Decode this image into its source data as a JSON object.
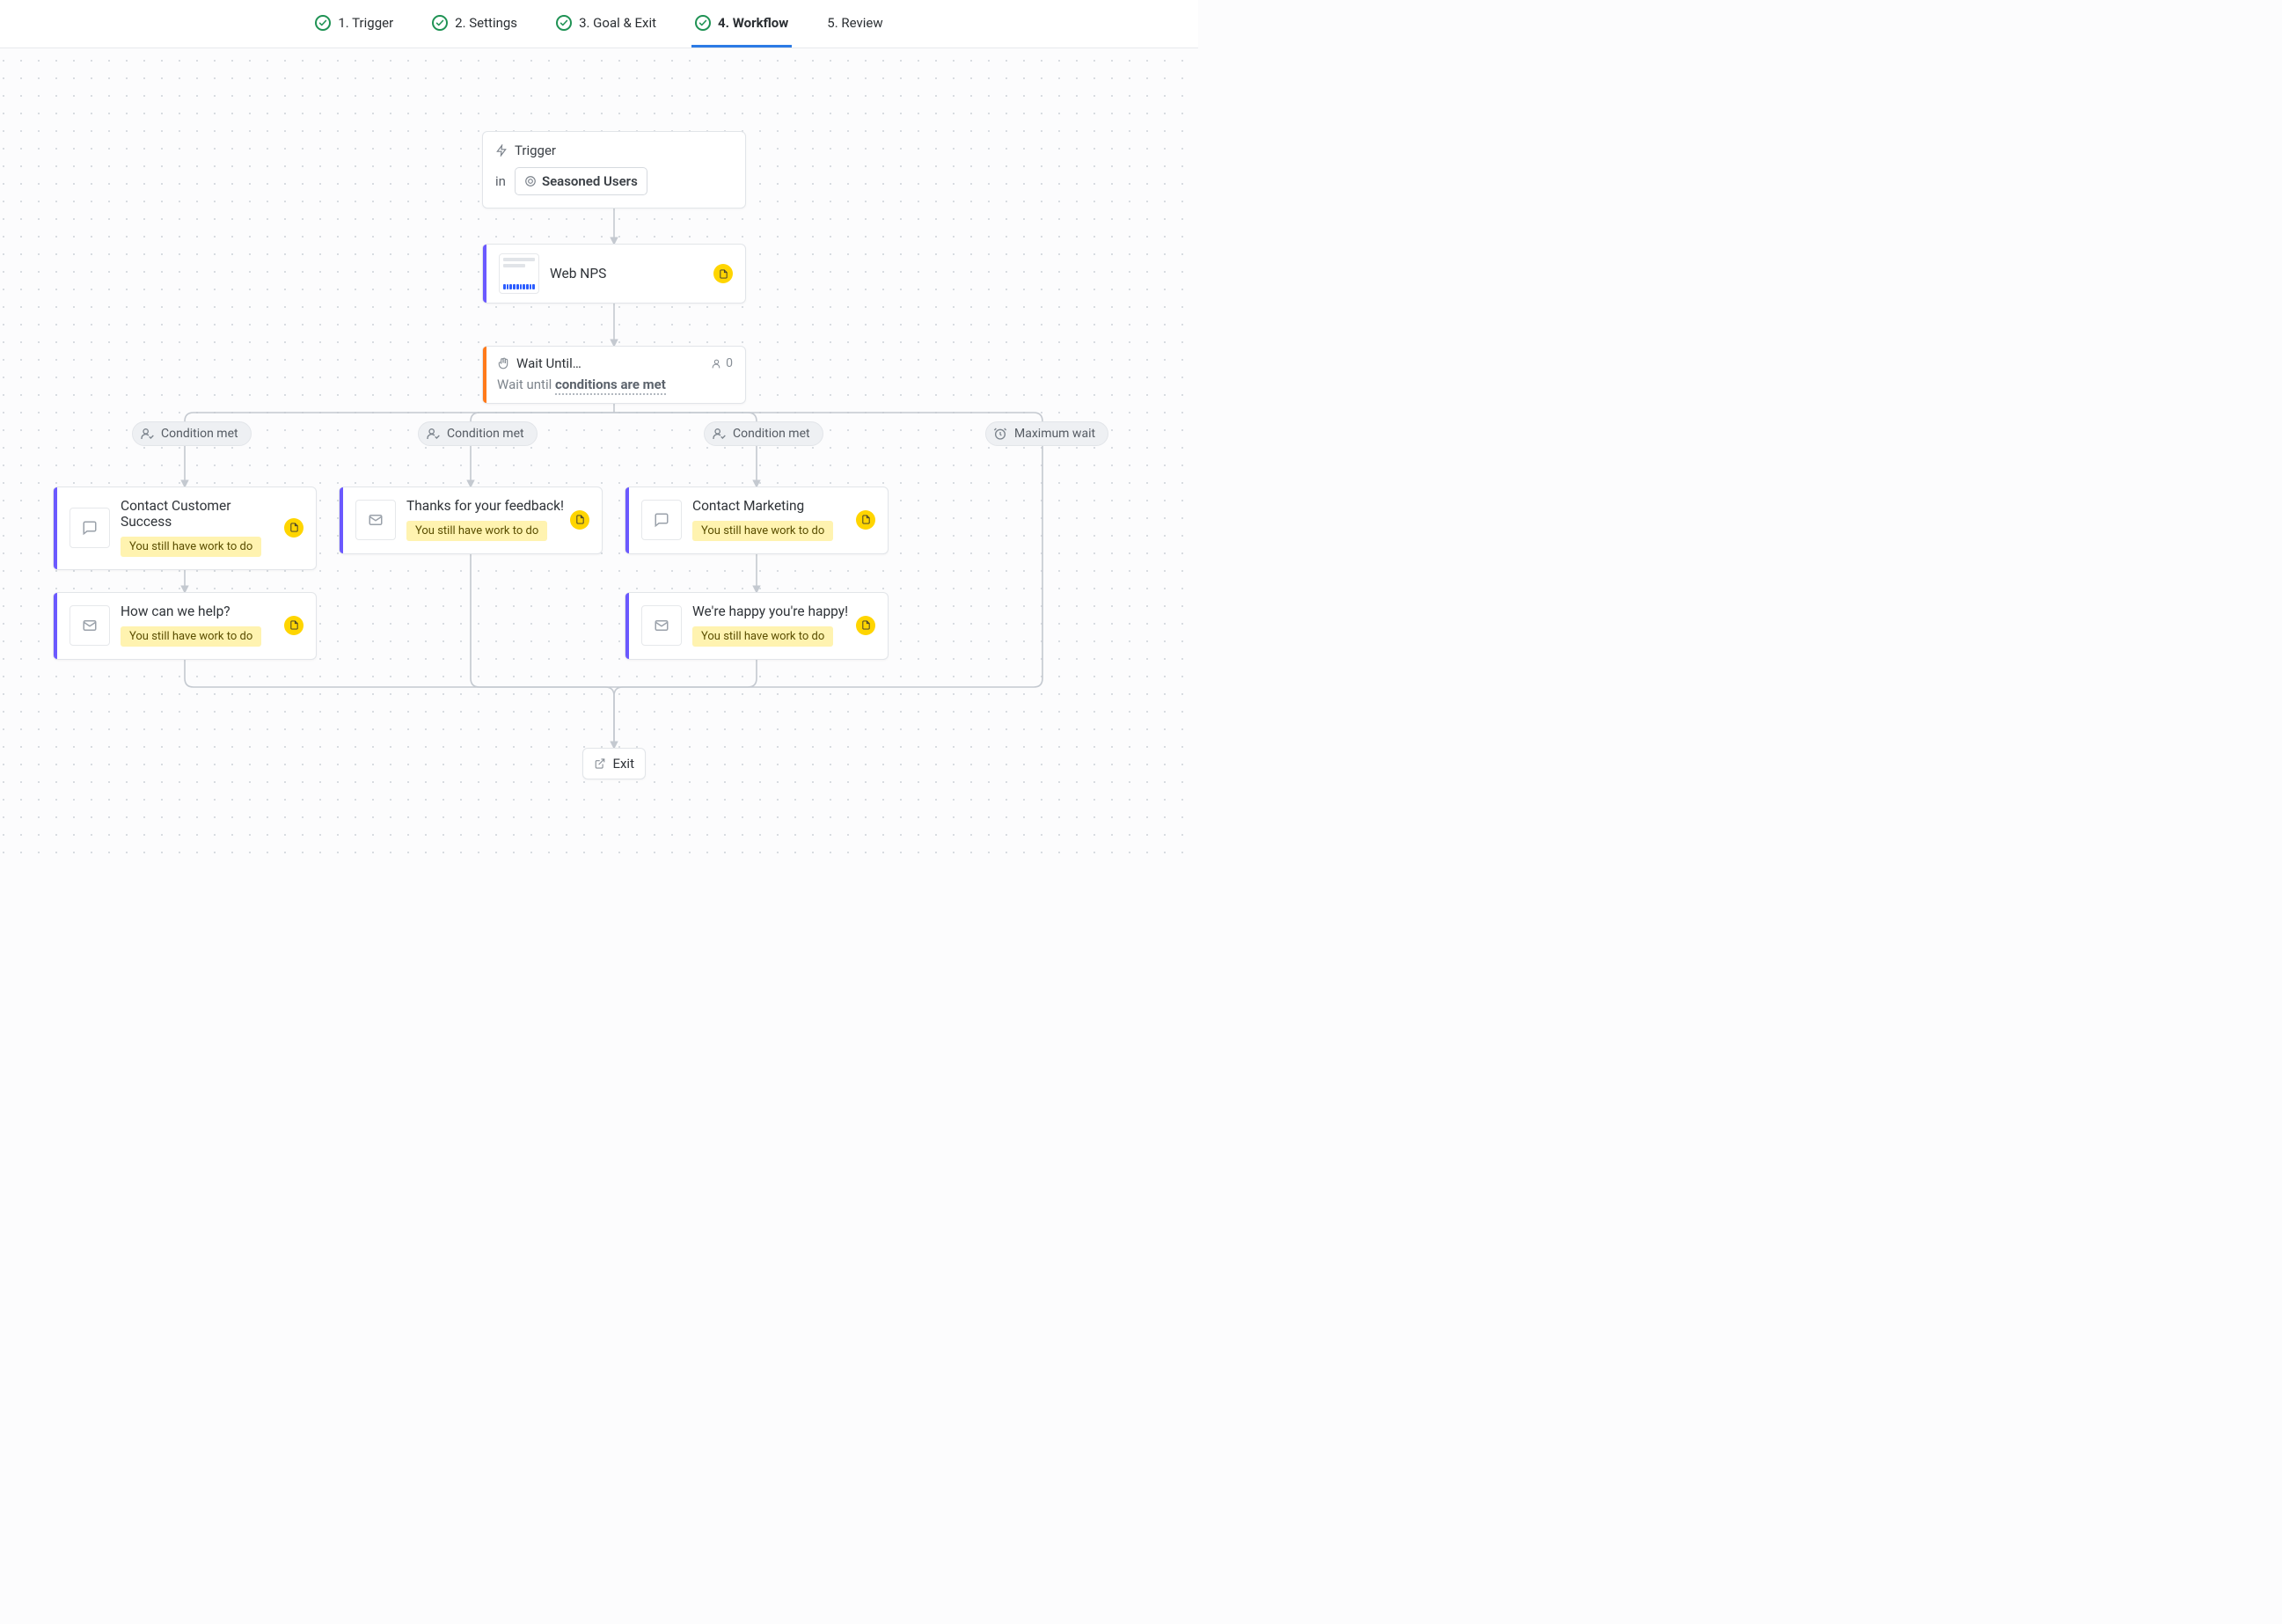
{
  "tabs": [
    {
      "label": "1. Trigger",
      "done": true,
      "active": false
    },
    {
      "label": "2. Settings",
      "done": true,
      "active": false
    },
    {
      "label": "3. Goal & Exit",
      "done": true,
      "active": false
    },
    {
      "label": "4. Workflow",
      "done": true,
      "active": true
    },
    {
      "label": "5. Review",
      "done": false,
      "active": false
    }
  ],
  "trigger": {
    "title": "Trigger",
    "in": "in",
    "audience": "Seasoned Users"
  },
  "nodes": {
    "web_nps": {
      "title": "Web NPS"
    },
    "wait": {
      "title": "Wait Until…",
      "count": "0",
      "sub_prefix": "Wait until ",
      "sub_bold": "conditions are met"
    },
    "contact_cs": {
      "title": "Contact Customer Success"
    },
    "how_help": {
      "title": "How can we help?"
    },
    "thanks": {
      "title": "Thanks for your feedback!"
    },
    "contact_mkt": {
      "title": "Contact Marketing"
    },
    "happy": {
      "title": "We're happy you're happy!"
    }
  },
  "todo_label": "You still have work to do",
  "branch_labels": {
    "condition_met": "Condition met",
    "maximum_wait": "Maximum wait"
  },
  "exit_label": "Exit",
  "colors": {
    "purple": "#6b59ff",
    "orange": "#ff7a1a"
  }
}
